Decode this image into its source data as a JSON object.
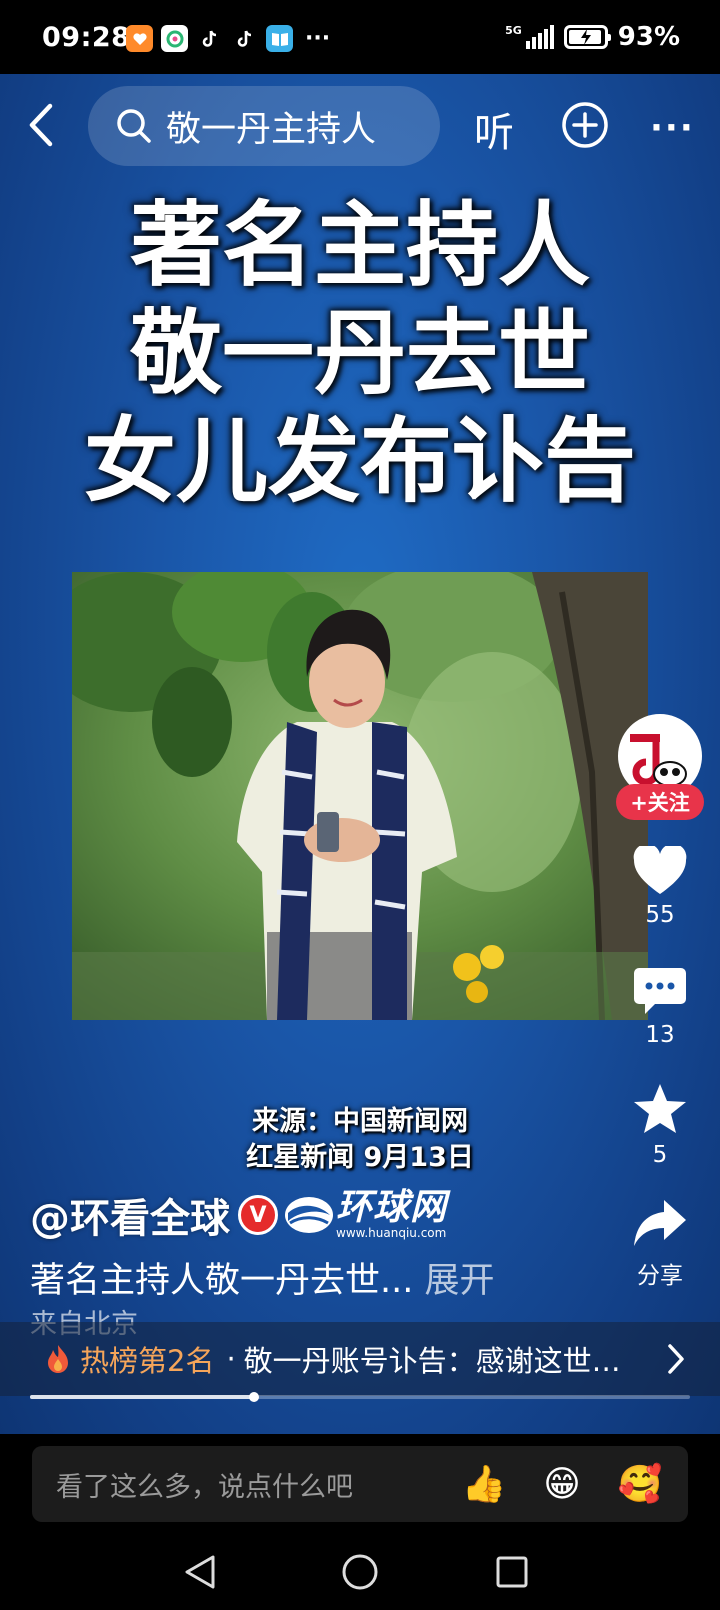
{
  "status_bar": {
    "time": "09:28",
    "network": "5G",
    "battery_percent": "93%",
    "battery_level": 0.93,
    "more_dots": "···"
  },
  "top_bar": {
    "search_text": "敬一丹主持人",
    "listen_label": "听",
    "more_dots": "···"
  },
  "video": {
    "headline_lines": [
      "著名主持人",
      "敬一丹去世",
      "女儿发布讣告"
    ],
    "source_line1": "来源：中国新闻网",
    "source_line2": "红星新闻 9月13日",
    "logo_text": "环球网",
    "logo_url": "www.huanqiu.com"
  },
  "author": {
    "name": "@环看全球",
    "verified_mark": "V",
    "description": "著名主持人敬一丹去世...",
    "expand_label": "展开",
    "location": "来自北京"
  },
  "rail": {
    "follow_label": "+关注",
    "likes": "55",
    "comments": "13",
    "favorites": "5",
    "share_label": "分享"
  },
  "hot": {
    "rank_label": "热榜第2名",
    "separator": "·",
    "text": "敬一丹账号讣告：感谢这世…"
  },
  "playback": {
    "progress": 0.34
  },
  "comment_bar": {
    "placeholder": "看了这么多，说点什么吧",
    "emojis": [
      "👍",
      "😁",
      "🥰"
    ]
  },
  "colors": {
    "background_blue": "#1a56a8",
    "follow_red": "#e8344a",
    "hot_orange": "#f5a55a"
  }
}
